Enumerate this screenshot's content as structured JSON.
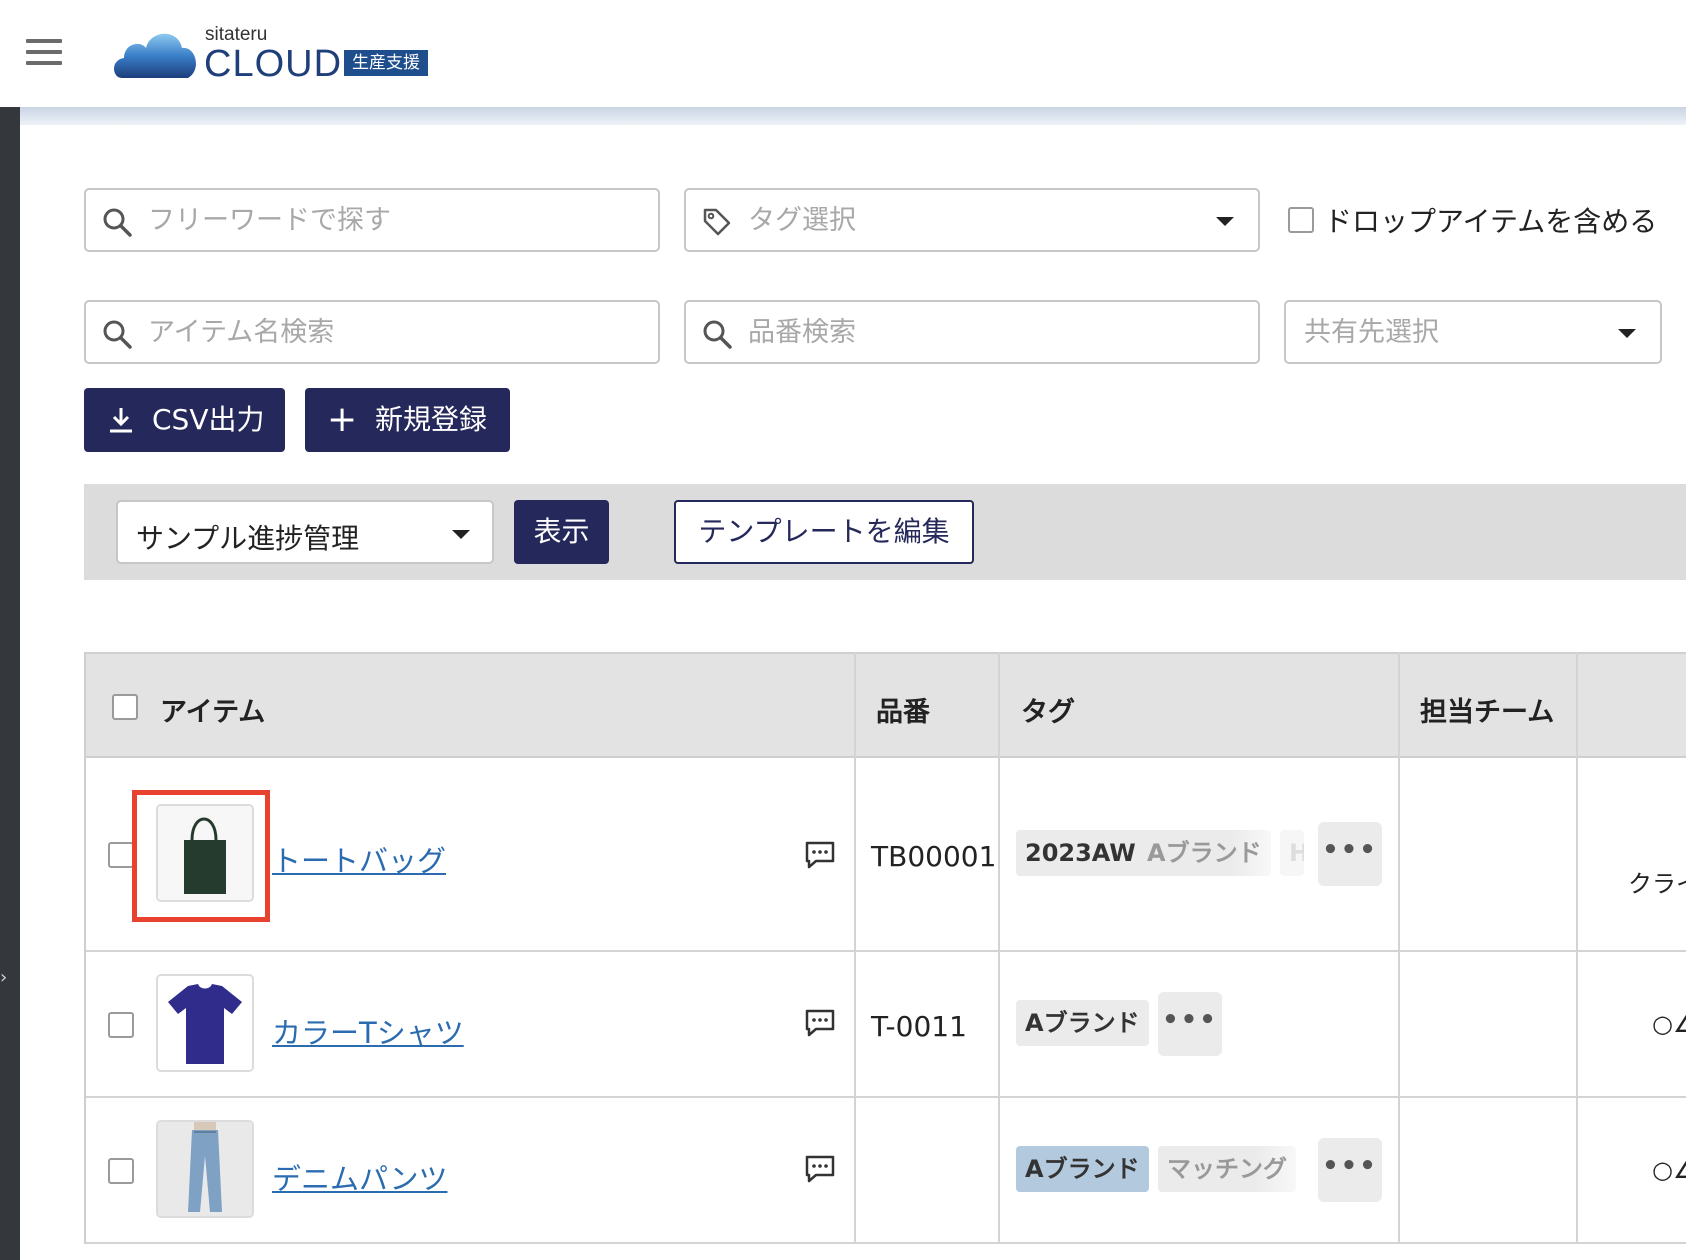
{
  "header": {
    "logo_small": "sitateru",
    "logo_main": "CLOUD",
    "logo_badge": "生産支援"
  },
  "filters": {
    "freeword_placeholder": "フリーワードで探す",
    "tag_placeholder": "タグ選択",
    "include_drop_label": "ドロップアイテムを含める",
    "item_name_placeholder": "アイテム名検索",
    "sku_placeholder": "品番検索",
    "share_placeholder": "共有先選択"
  },
  "actions": {
    "csv_label": "CSV出力",
    "new_label": "新規登録"
  },
  "template_bar": {
    "selected": "サンプル進捗管理",
    "show_label": "表示",
    "edit_label": "テンプレートを編集"
  },
  "table": {
    "headers": [
      "アイテム",
      "品番",
      "タグ",
      "担当チーム"
    ],
    "rows": [
      {
        "name": "トートバッグ",
        "sku": "TB00001",
        "tags": [
          "2023AW",
          "Aブランド",
          "H"
        ],
        "extra": "クライ"
      },
      {
        "name": "カラーTシャツ",
        "sku": "T-0011",
        "tags": [
          "Aブランド"
        ],
        "extra": "○∠"
      },
      {
        "name": "デニムパンツ",
        "sku": "",
        "tags": [
          "Aブランド",
          "マッチング"
        ],
        "extra": "○∠"
      }
    ],
    "more_label": "•••"
  },
  "colors": {
    "navy": "#25285a",
    "link": "#2b6cb0",
    "highlight": "#e8412d"
  }
}
